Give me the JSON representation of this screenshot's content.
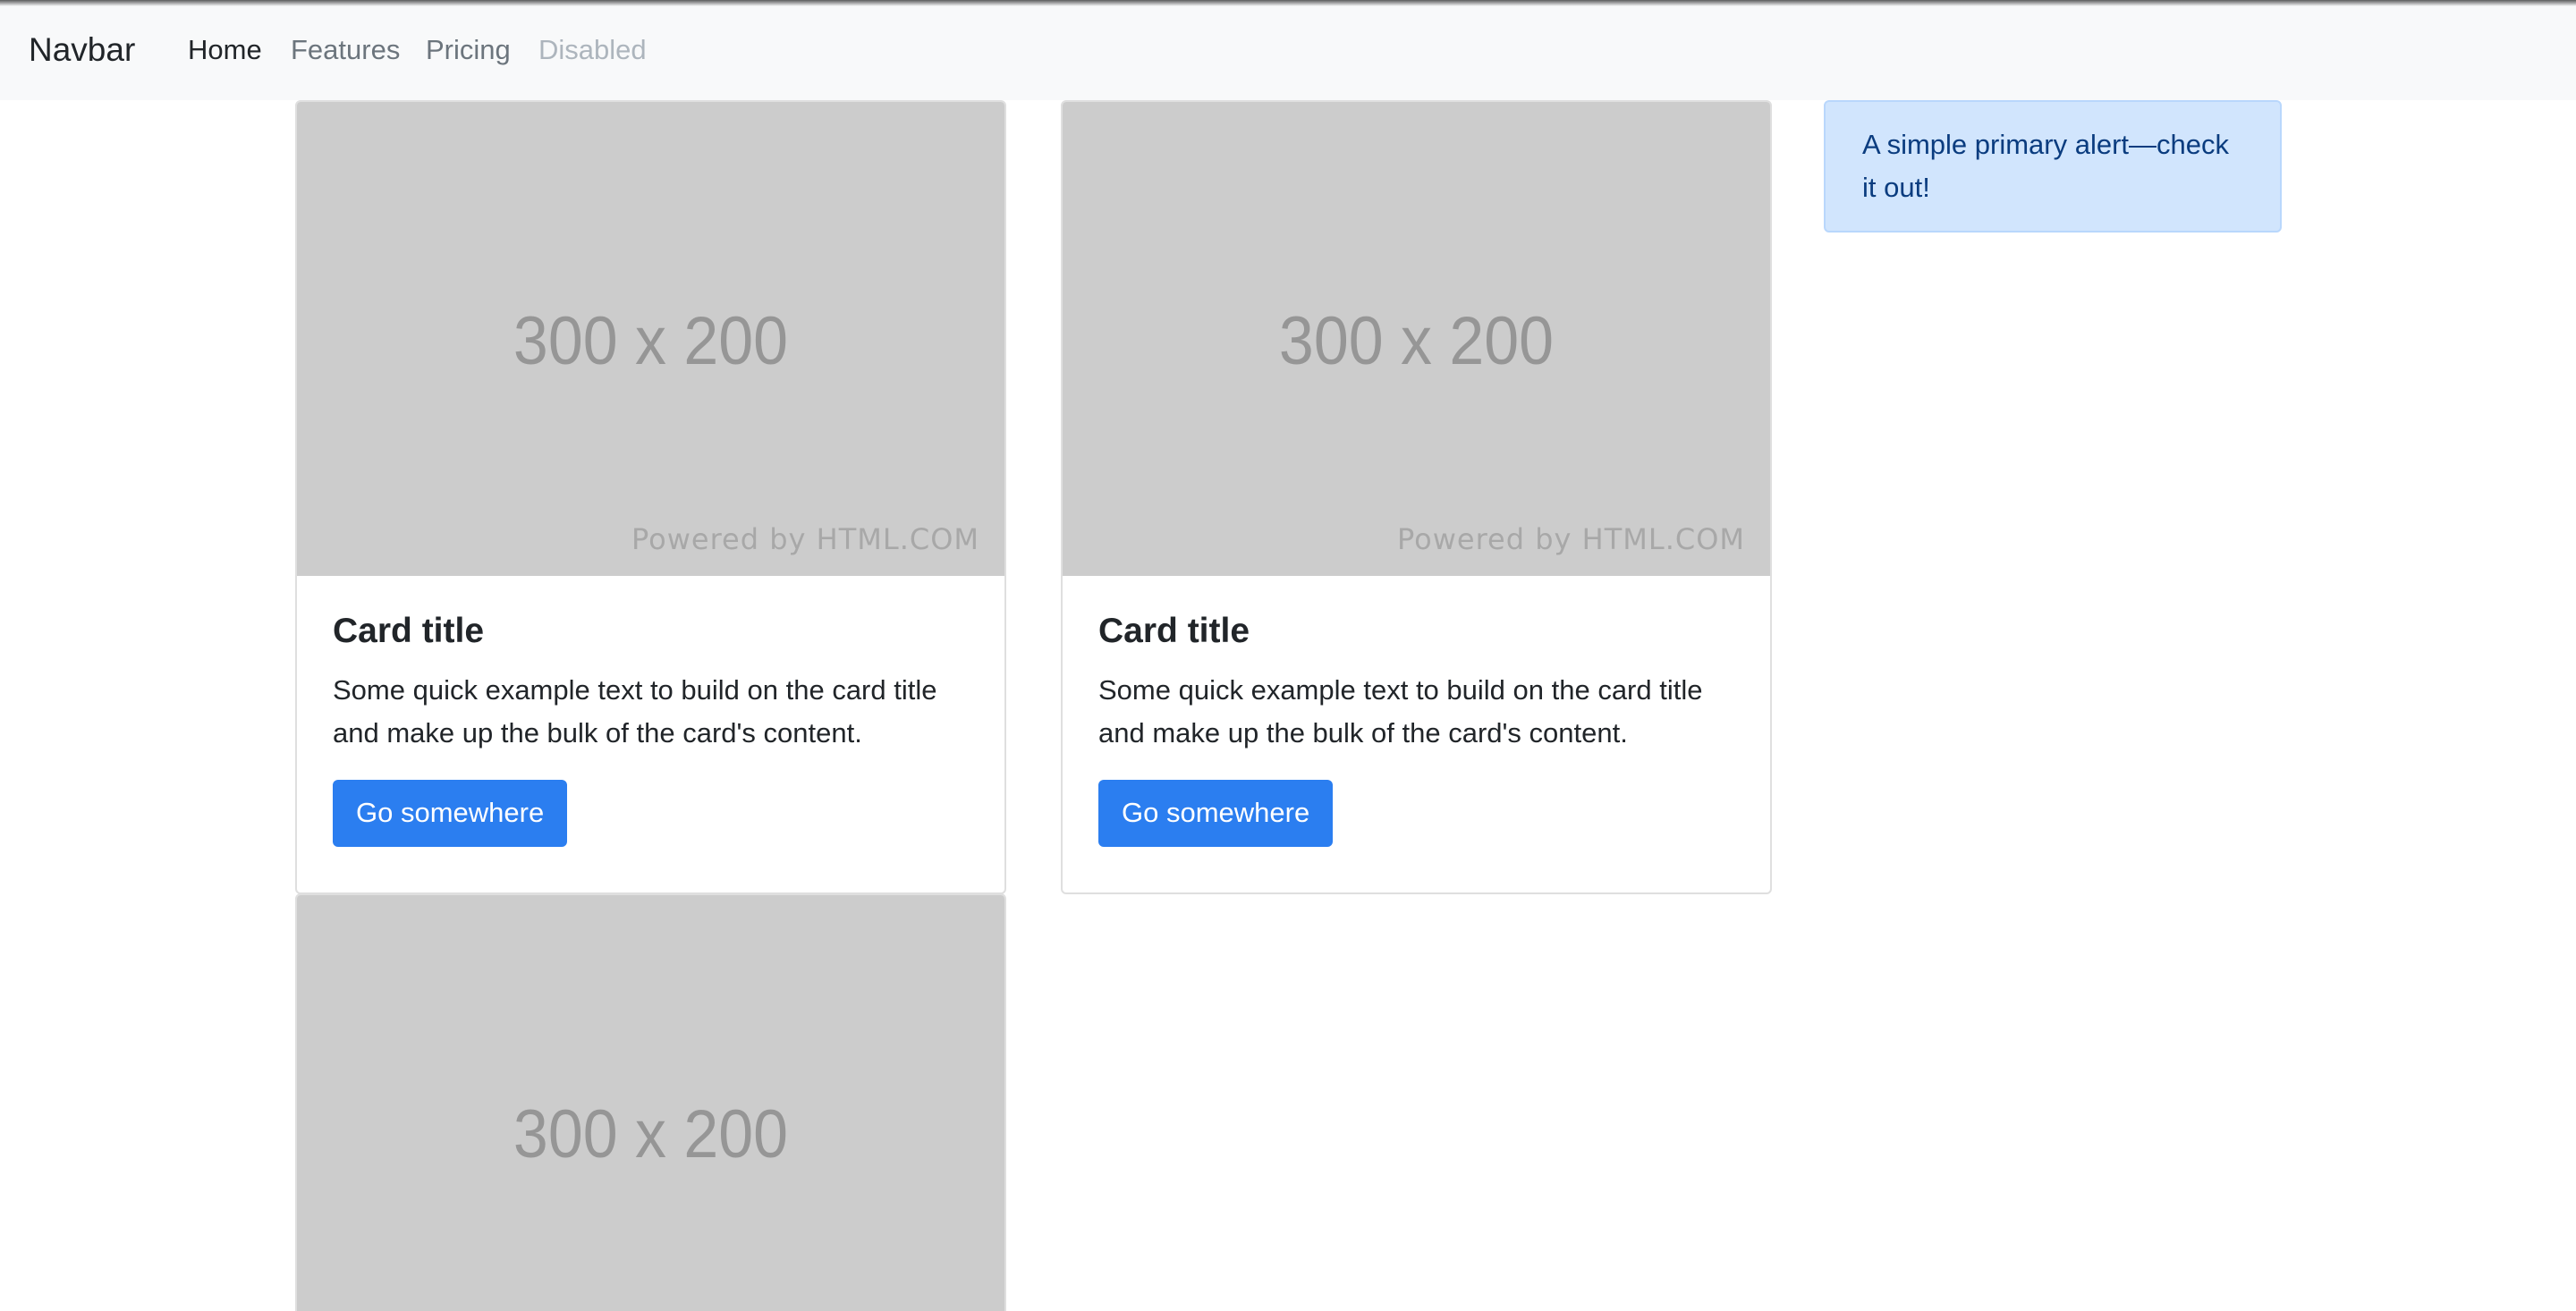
{
  "navbar": {
    "brand": "Navbar",
    "links": [
      {
        "label": "Home",
        "state": "active"
      },
      {
        "label": "Features",
        "state": "normal"
      },
      {
        "label": "Pricing",
        "state": "normal"
      },
      {
        "label": "Disabled",
        "state": "disabled"
      }
    ]
  },
  "cards": [
    {
      "image_label": "300 x 200",
      "image_watermark": "Powered by HTML.COM",
      "title": "Card title",
      "text": "Some quick example text to build on the card title and make up the bulk of the card's content.",
      "button": "Go somewhere"
    },
    {
      "image_label": "300 x 200",
      "image_watermark": "Powered by HTML.COM",
      "title": "Card title",
      "text": "Some quick example text to build on the card title and make up the bulk of the card's content.",
      "button": "Go somewhere"
    },
    {
      "image_label": "300 x 200"
    }
  ],
  "alert": {
    "text": "A simple primary alert—check it out!"
  },
  "colors": {
    "navbar_bg": "#f8f9fa",
    "primary": "#2b7ef0",
    "alert_bg": "#d1e5fd",
    "alert_text": "#0a3c7f",
    "placeholder_bg": "#cccccc"
  }
}
